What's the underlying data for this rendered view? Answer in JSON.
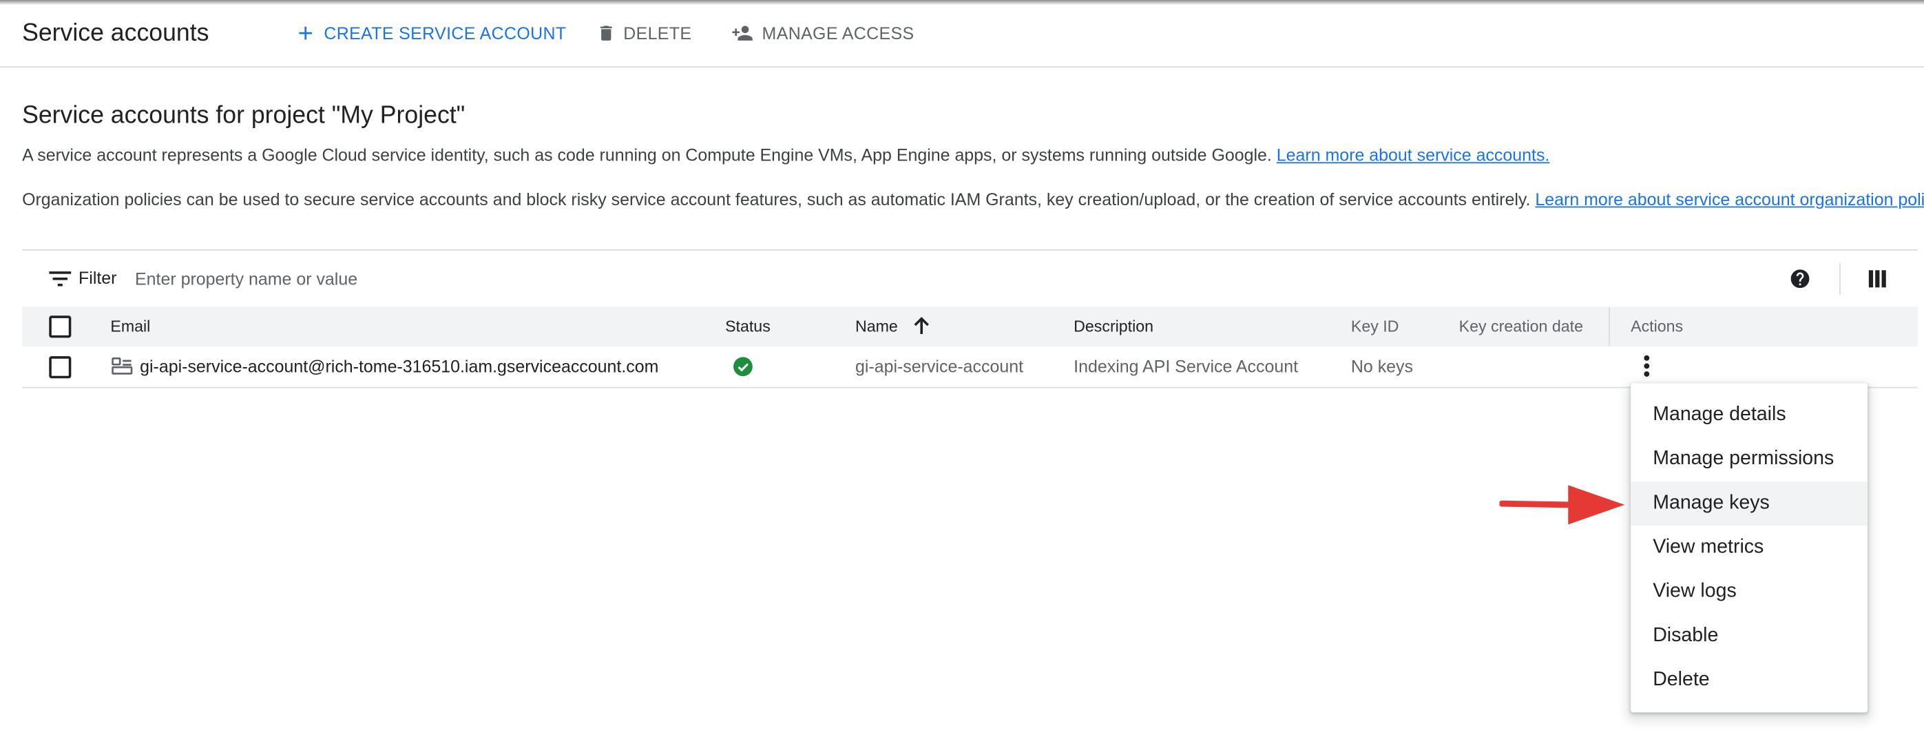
{
  "header": {
    "title": "Service accounts",
    "create_label": "CREATE SERVICE ACCOUNT",
    "delete_label": "DELETE",
    "manage_access_label": "MANAGE ACCESS"
  },
  "intro": {
    "heading": "Service accounts for project \"My Project\"",
    "para1": "A service account represents a Google Cloud service identity, such as code running on Compute Engine VMs, App Engine apps, or systems running outside Google.",
    "para1_link": "Learn more about service accounts.",
    "para2": "Organization policies can be used to secure service accounts and block risky service account features, such as automatic IAM Grants, key creation/upload, or the creation of service accounts entirely.",
    "para2_link": "Learn more about service account organization policies."
  },
  "filter": {
    "label": "Filter",
    "placeholder": "Enter property name or value"
  },
  "table": {
    "columns": {
      "email": "Email",
      "status": "Status",
      "name": "Name",
      "description": "Description",
      "key_id": "Key ID",
      "key_creation_date": "Key creation date",
      "actions": "Actions"
    },
    "rows": [
      {
        "email": "gi-api-service-account@rich-tome-316510.iam.gserviceaccount.com",
        "status": "enabled",
        "name": "gi-api-service-account",
        "description": "Indexing API Service Account",
        "key_id": "No keys",
        "key_creation_date": ""
      }
    ]
  },
  "actions_menu": {
    "items": [
      "Manage details",
      "Manage permissions",
      "Manage keys",
      "View metrics",
      "View logs",
      "Disable",
      "Delete"
    ],
    "highlighted": "Manage keys"
  },
  "colors": {
    "accent": "#1a73e8",
    "status_ok": "#1e8e3e",
    "annotation_arrow": "#e53935",
    "header_bg": "#f1f3f4",
    "border": "#dadce0"
  },
  "icons": {
    "create": "add-icon",
    "delete": "trash-icon",
    "manage_access": "person-add-icon",
    "filter": "filter-list-icon",
    "help": "help-circle-icon",
    "columns": "view-column-icon",
    "sort": "arrow-up-icon",
    "service_account": "service-account-icon",
    "status": "check-circle-icon",
    "row_actions": "more-vert-icon"
  }
}
